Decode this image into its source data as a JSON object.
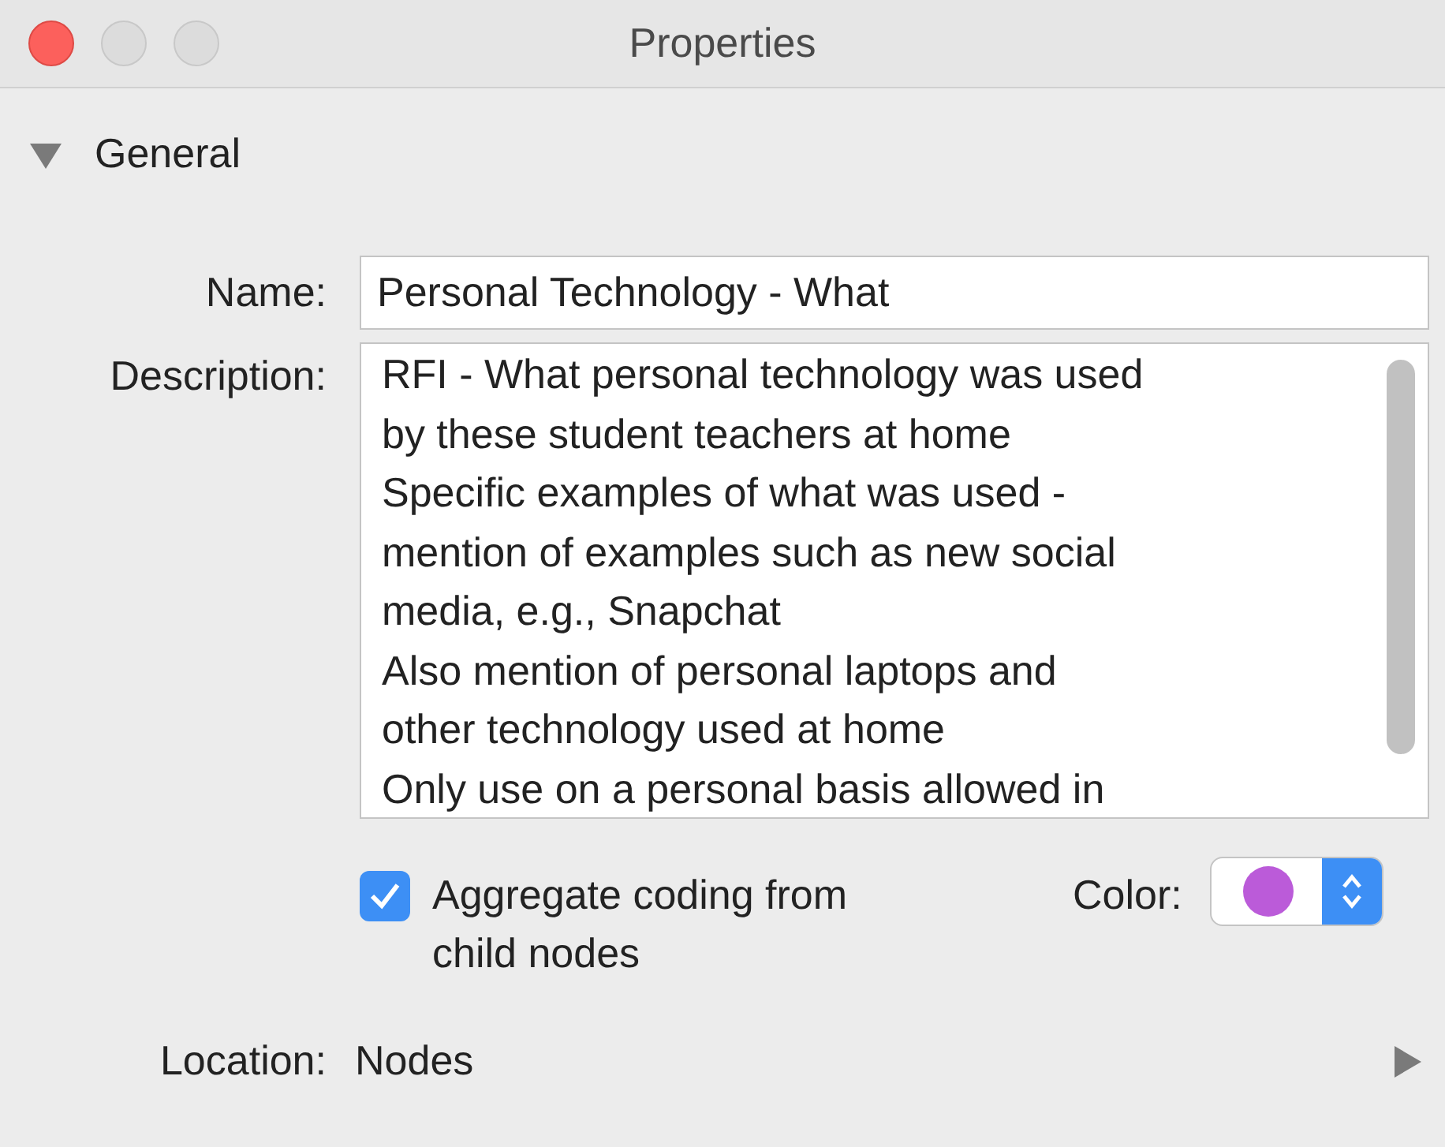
{
  "window": {
    "title": "Properties"
  },
  "section": {
    "label": "General",
    "expanded": true
  },
  "name_field": {
    "label": "Name:",
    "value": "Personal Technology - What"
  },
  "description": {
    "label": "Description:",
    "lines": [
      "RFI - What personal technology was used",
      "by these student teachers at home",
      "Specific examples of what was used -",
      "mention of examples such as new social",
      "media, e.g., Snapchat",
      "Also mention of personal laptops and",
      "other technology used at home",
      "Only use on a personal basis allowed in"
    ]
  },
  "aggregate": {
    "label": "Aggregate coding from child nodes",
    "checked": true
  },
  "color": {
    "label": "Color:",
    "color": "#bb5bd9"
  },
  "location": {
    "label": "Location:",
    "value": "Nodes"
  }
}
